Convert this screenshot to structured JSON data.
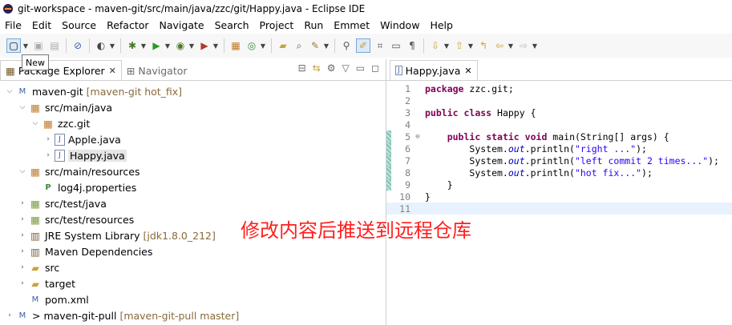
{
  "window": {
    "title": "git-workspace - maven-git/src/main/java/zzc/git/Happy.java - Eclipse IDE"
  },
  "menu": [
    "File",
    "Edit",
    "Source",
    "Refactor",
    "Navigate",
    "Search",
    "Project",
    "Run",
    "Emmet",
    "Window",
    "Help"
  ],
  "tooltip": {
    "text": "New"
  },
  "left_tabs": [
    {
      "label": "Package Explorer",
      "close": "✕"
    },
    {
      "label": "Navigator"
    }
  ],
  "tree": [
    {
      "label": "maven-git",
      "decoration": "[maven-git hot_fix]"
    },
    {
      "label": "src/main/java"
    },
    {
      "label": "zzc.git"
    },
    {
      "label": "Apple.java"
    },
    {
      "label": "Happy.java"
    },
    {
      "label": "src/main/resources"
    },
    {
      "label": "log4j.properties"
    },
    {
      "label": "src/test/java"
    },
    {
      "label": "src/test/resources"
    },
    {
      "label": "JRE System Library",
      "decoration": "[jdk1.8.0_212]"
    },
    {
      "label": "Maven Dependencies"
    },
    {
      "label": "src"
    },
    {
      "label": "target"
    },
    {
      "label": "pom.xml"
    },
    {
      "label": "> maven-git-pull",
      "decoration": "[maven-git-pull master]"
    }
  ],
  "editor": {
    "tab": {
      "label": "Happy.java",
      "close": "✕"
    },
    "line_numbers": [
      "1",
      "2",
      "3",
      "4",
      "5",
      "6",
      "7",
      "8",
      "9",
      "10",
      "11"
    ],
    "code": {
      "l1_kw": "package",
      "l1_rest": " zzc.git;",
      "l3_kw1": "public",
      "l3_kw2": "class",
      "l3_rest": " Happy {",
      "l5_kw1": "public",
      "l5_kw2": "static",
      "l5_kw3": "void",
      "l5_rest": " main(String[] args) {",
      "l6_a": "System.",
      "l6_f": "out",
      "l6_b": ".println(",
      "l6_s": "\"right ...\"",
      "l6_c": ");",
      "l7_a": "System.",
      "l7_f": "out",
      "l7_b": ".println(",
      "l7_s": "\"left commit 2 times...\"",
      "l7_c": ");",
      "l8_a": "System.",
      "l8_f": "out",
      "l8_b": ".println(",
      "l8_s": "\"hot fix...\"",
      "l8_c": ");",
      "l9": "    }",
      "l10": "}"
    }
  },
  "overlay_text": "修改内容后推送到远程仓库",
  "colors": {
    "keyword": "#7f0055",
    "string": "#2a00ff",
    "field": "#0000c0",
    "overlay": "#ff1e1e"
  }
}
